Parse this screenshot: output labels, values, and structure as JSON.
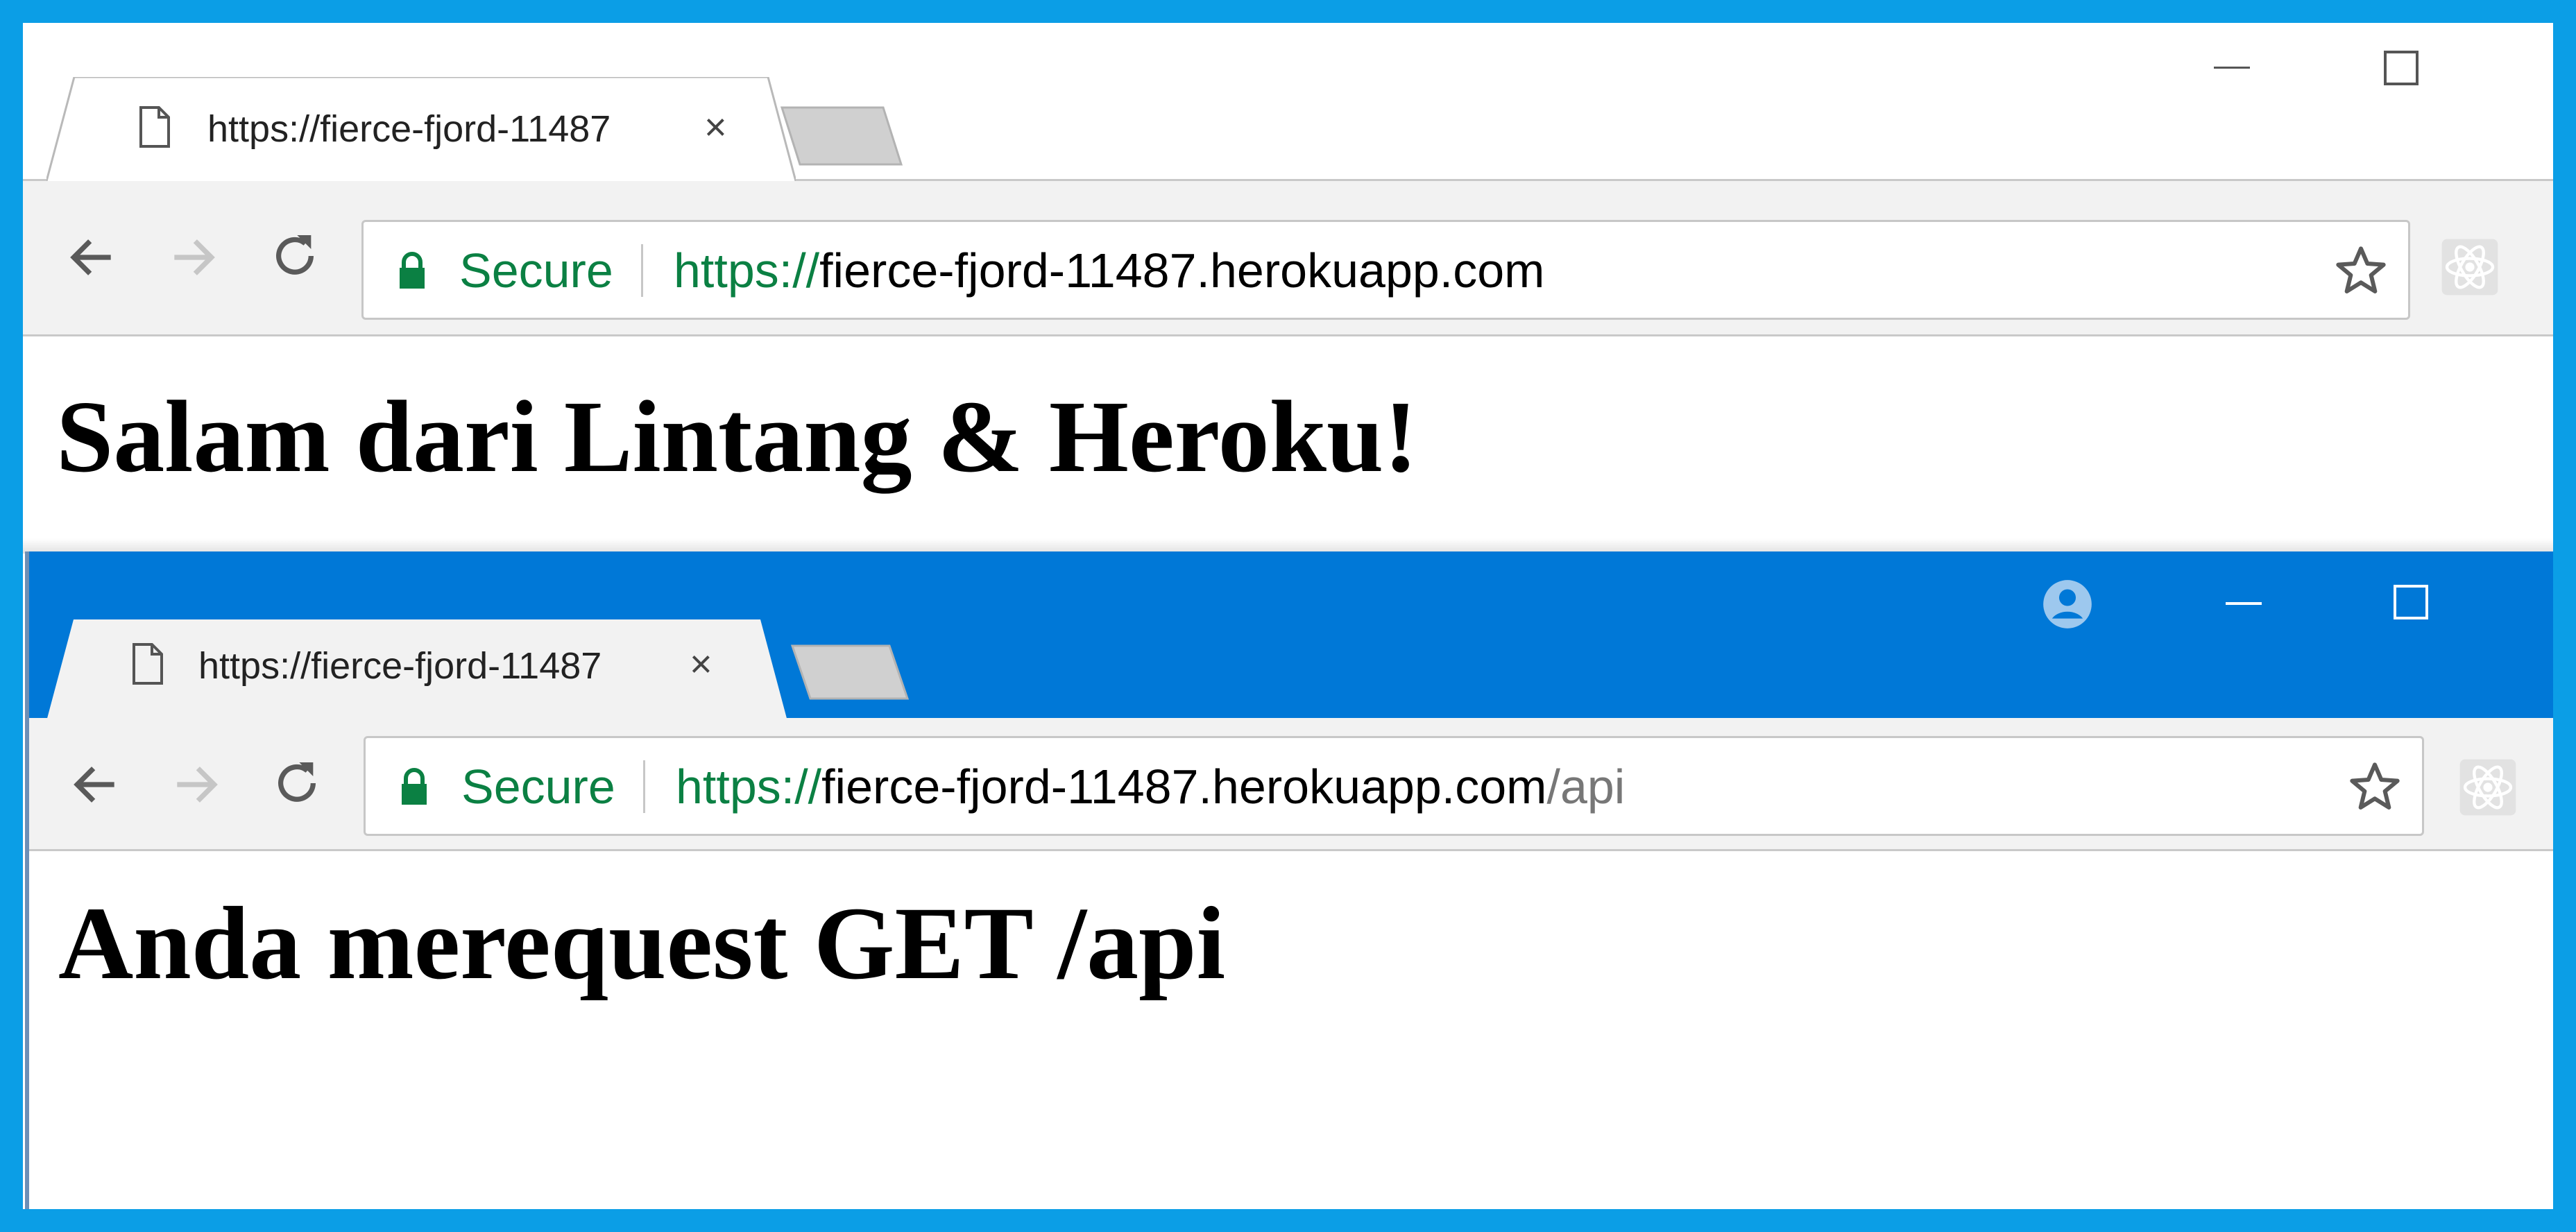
{
  "colors": {
    "frame": "#00a2ed",
    "titlebar_active": "#0078d7",
    "secure_green": "#0b8043"
  },
  "window1": {
    "tab": {
      "title": "https://fierce-fjord-11487",
      "close": "×",
      "icon": "file-icon"
    },
    "controls": {
      "minimize": "—",
      "maximize": "☐"
    },
    "toolbar": {
      "back_icon": "arrow-left-icon",
      "forward_icon": "arrow-right-icon",
      "reload_icon": "reload-icon",
      "secure_label": "Secure",
      "url_scheme": "https://",
      "url_host": "fierce-fjord-11487.herokuapp.com",
      "url_path": "",
      "bookmark_icon": "star-icon",
      "extension_icon": "react-devtools-icon"
    },
    "heading": "Salam dari Lintang & Heroku!"
  },
  "window2": {
    "tab": {
      "title": "https://fierce-fjord-11487",
      "close": "×",
      "icon": "file-icon"
    },
    "controls": {
      "profile_icon": "account-circle-icon",
      "minimize": "—",
      "maximize": "☐"
    },
    "toolbar": {
      "back_icon": "arrow-left-icon",
      "forward_icon": "arrow-right-icon",
      "reload_icon": "reload-icon",
      "secure_label": "Secure",
      "url_scheme": "https://",
      "url_host": "fierce-fjord-11487.herokuapp.com",
      "url_path": "/api",
      "bookmark_icon": "star-icon",
      "extension_icon": "react-devtools-icon"
    },
    "heading": "Anda merequest GET /api"
  }
}
